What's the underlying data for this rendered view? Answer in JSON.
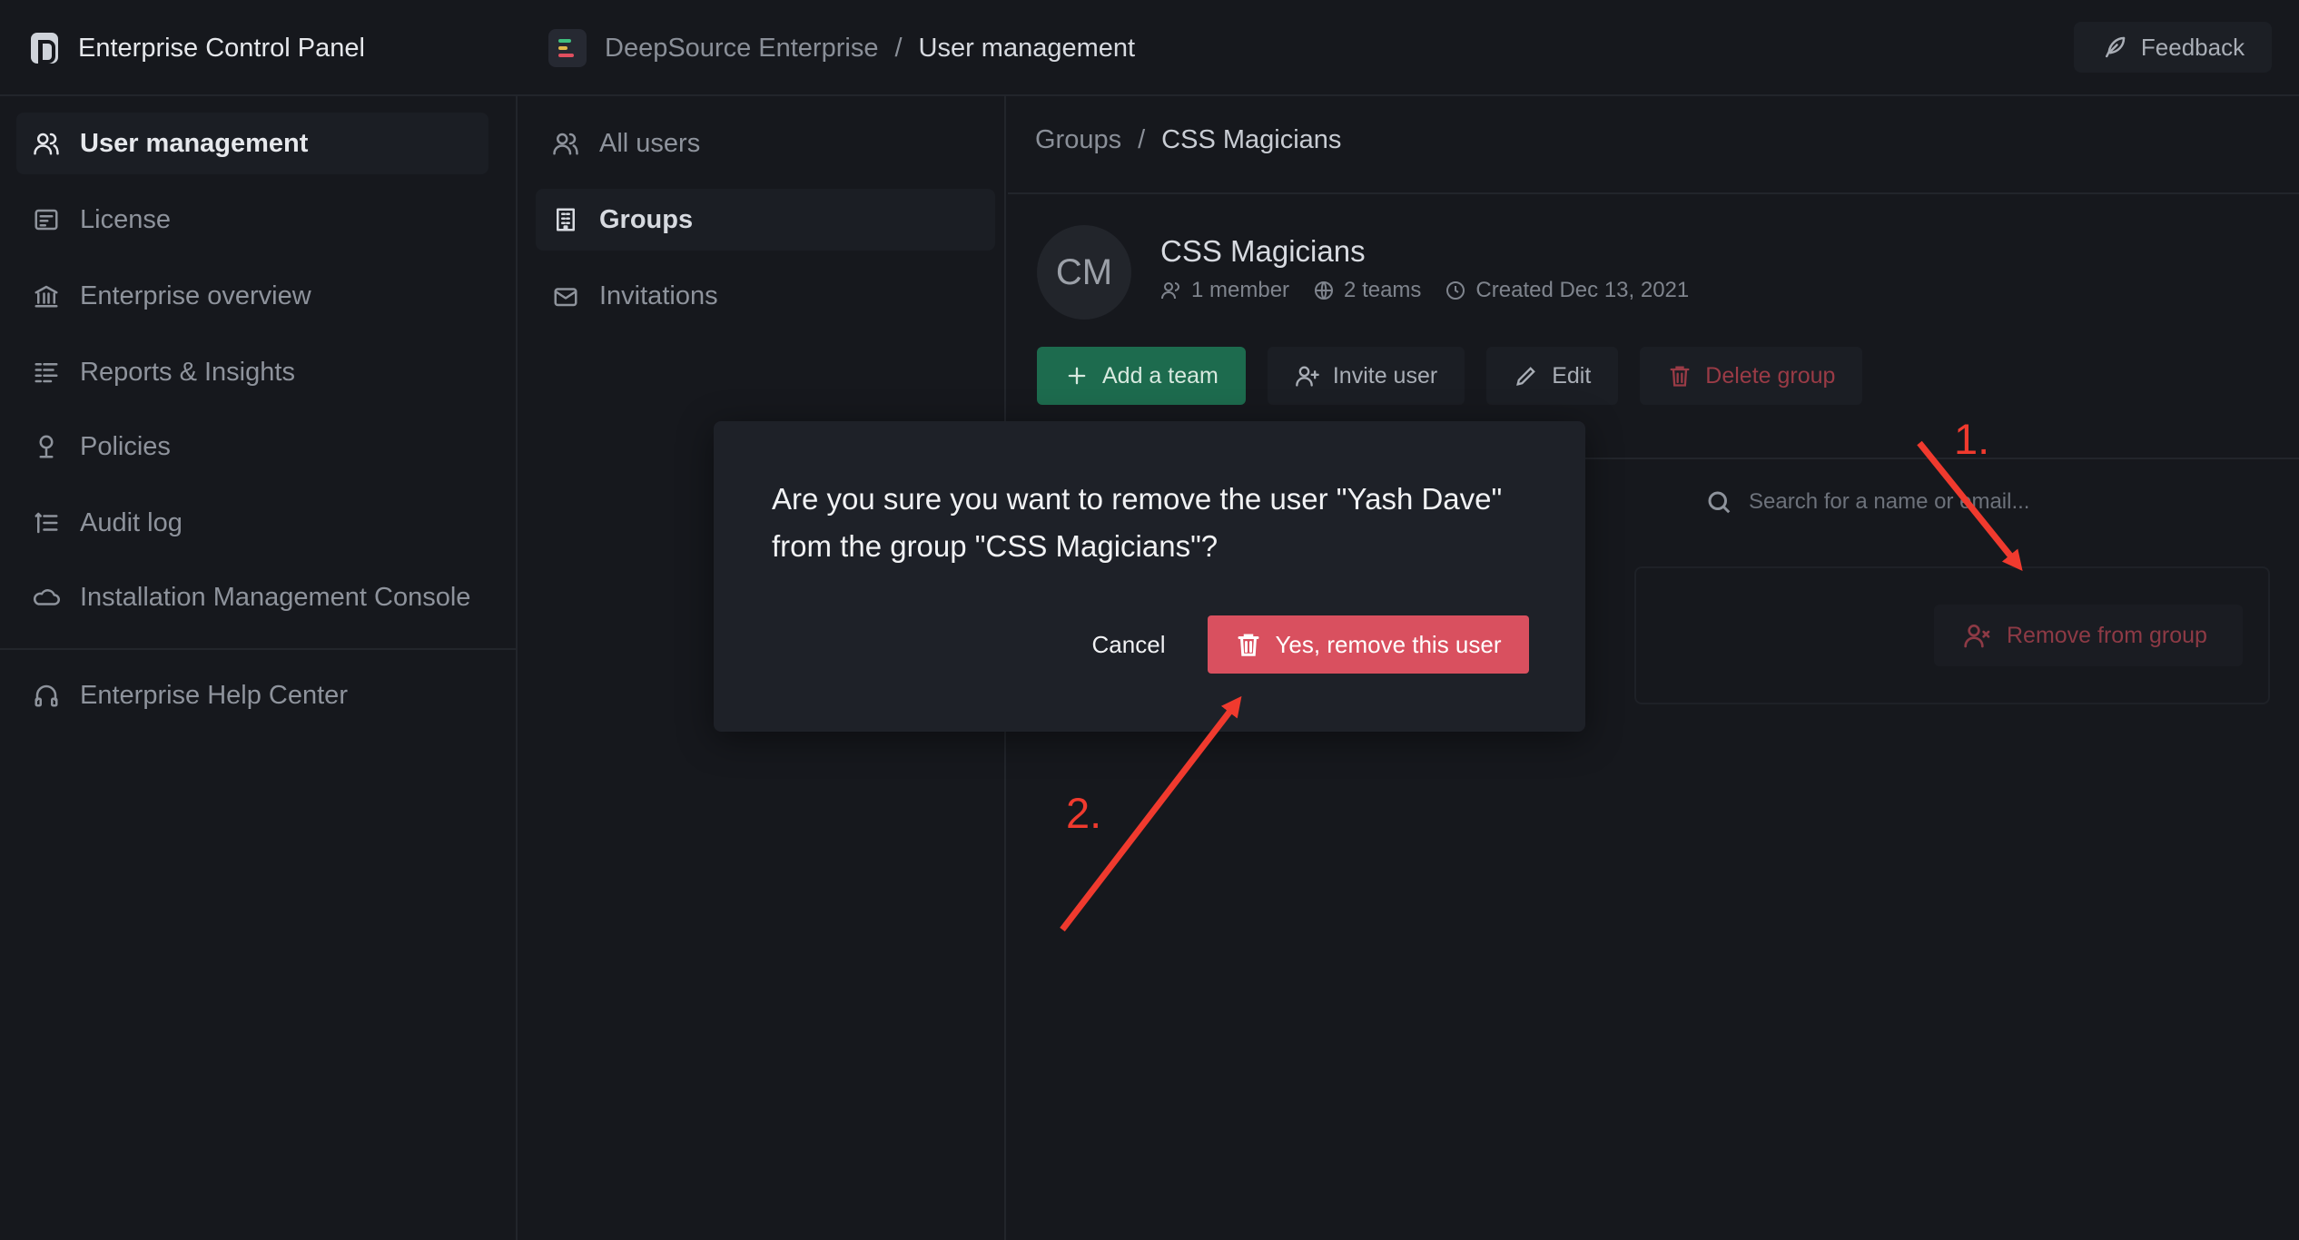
{
  "app": {
    "title": "Enterprise Control Panel"
  },
  "topbar": {
    "org_name": "DeepSource Enterprise",
    "separator": "/",
    "current_page": "User management",
    "feedback_label": "Feedback"
  },
  "sidebar": {
    "items": [
      {
        "label": "User management",
        "icon": "users-icon"
      },
      {
        "label": "License",
        "icon": "license-icon"
      },
      {
        "label": "Enterprise overview",
        "icon": "bank-icon"
      },
      {
        "label": "Reports & Insights",
        "icon": "reports-icon"
      },
      {
        "label": "Policies",
        "icon": "policies-icon"
      },
      {
        "label": "Audit log",
        "icon": "audit-log-icon"
      },
      {
        "label": "Installation Management Console",
        "icon": "cloud-icon"
      }
    ],
    "help_label": "Enterprise Help Center"
  },
  "subnav": {
    "items": [
      {
        "label": "All users",
        "icon": "users-icon"
      },
      {
        "label": "Groups",
        "icon": "building-icon"
      },
      {
        "label": "Invitations",
        "icon": "mail-icon"
      }
    ]
  },
  "main": {
    "breadcrumb_parent": "Groups",
    "breadcrumb_sep": "/",
    "breadcrumb_current": "CSS Magicians",
    "avatar_initials": "CM",
    "group_name": "CSS Magicians",
    "members": "1 member",
    "teams": "2 teams",
    "created": "Created Dec 13, 2021",
    "actions": {
      "add_team": "Add a team",
      "invite_user": "Invite user",
      "edit": "Edit",
      "delete_group": "Delete group"
    },
    "search_placeholder": "Search for a name or email...",
    "remove_from_group": "Remove from group"
  },
  "modal": {
    "message_line1": "Are you sure you want to remove the user \"Yash Dave\"",
    "message_line2": "from the group \"CSS Magicians\"?",
    "cancel_label": "Cancel",
    "confirm_label": "Yes, remove this user"
  },
  "annotations": {
    "step1": "1.",
    "step2": "2.",
    "color": "#f03a2e"
  },
  "colors": {
    "background": "#16181d",
    "primary_green": "#1d6b4e",
    "danger_red": "#d9505f"
  }
}
